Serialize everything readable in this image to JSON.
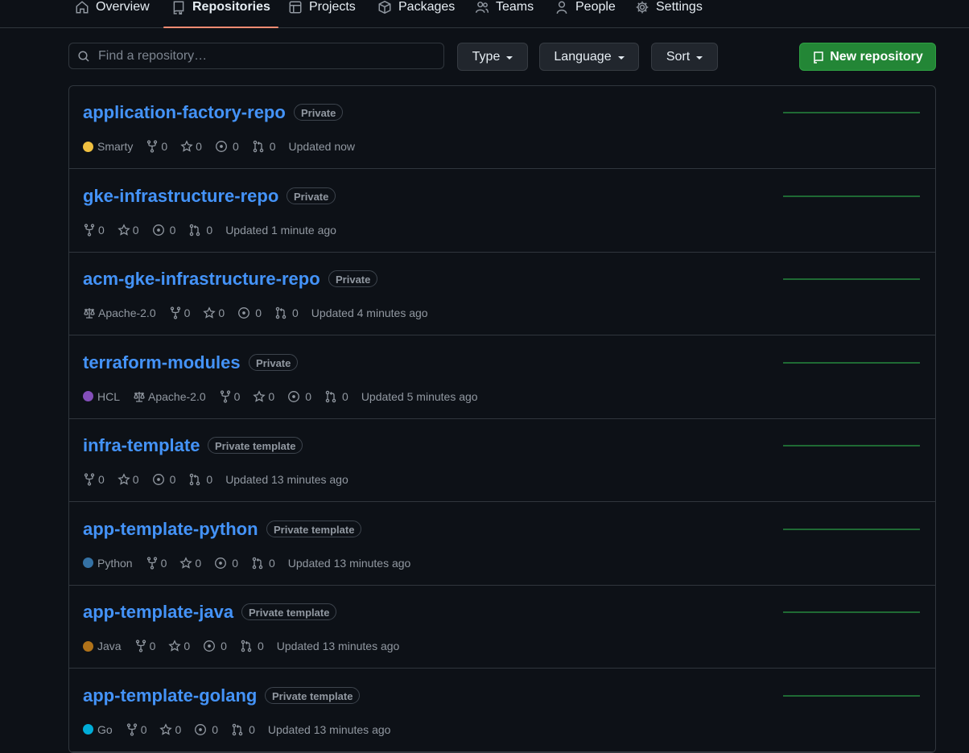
{
  "nav": {
    "tabs": [
      {
        "label": "Overview",
        "icon": "home-icon"
      },
      {
        "label": "Repositories",
        "icon": "repo-icon",
        "active": true
      },
      {
        "label": "Projects",
        "icon": "table-icon"
      },
      {
        "label": "Packages",
        "icon": "package-icon"
      },
      {
        "label": "Teams",
        "icon": "people-icon"
      },
      {
        "label": "People",
        "icon": "person-icon"
      },
      {
        "label": "Settings",
        "icon": "gear-icon"
      }
    ]
  },
  "toolbar": {
    "search_placeholder": "Find a repository…",
    "type_label": "Type",
    "language_label": "Language",
    "sort_label": "Sort",
    "new_repo_label": "New repository"
  },
  "colors": {
    "accent_link": "#4493f8",
    "primary_button": "#238636",
    "active_tab_underline": "#fd8c73",
    "Smarty": "#f0c040",
    "HCL": "#844fba",
    "Python": "#3572a5",
    "Java": "#b07219",
    "Go": "#00add8"
  },
  "repos": [
    {
      "name": "application-factory-repo",
      "visibility": "Private",
      "language": "Smarty",
      "license": "",
      "forks": "0",
      "stars": "0",
      "issues": "0",
      "prs": "0",
      "updated": "Updated now"
    },
    {
      "name": "gke-infrastructure-repo",
      "visibility": "Private",
      "language": "",
      "license": "",
      "forks": "0",
      "stars": "0",
      "issues": "0",
      "prs": "0",
      "updated": "Updated 1 minute ago"
    },
    {
      "name": "acm-gke-infrastructure-repo",
      "visibility": "Private",
      "language": "",
      "license": "Apache-2.0",
      "forks": "0",
      "stars": "0",
      "issues": "0",
      "prs": "0",
      "updated": "Updated 4 minutes ago"
    },
    {
      "name": "terraform-modules",
      "visibility": "Private",
      "language": "HCL",
      "license": "Apache-2.0",
      "forks": "0",
      "stars": "0",
      "issues": "0",
      "prs": "0",
      "updated": "Updated 5 minutes ago"
    },
    {
      "name": "infra-template",
      "visibility": "Private template",
      "language": "",
      "license": "",
      "forks": "0",
      "stars": "0",
      "issues": "0",
      "prs": "0",
      "updated": "Updated 13 minutes ago"
    },
    {
      "name": "app-template-python",
      "visibility": "Private template",
      "language": "Python",
      "license": "",
      "forks": "0",
      "stars": "0",
      "issues": "0",
      "prs": "0",
      "updated": "Updated 13 minutes ago"
    },
    {
      "name": "app-template-java",
      "visibility": "Private template",
      "language": "Java",
      "license": "",
      "forks": "0",
      "stars": "0",
      "issues": "0",
      "prs": "0",
      "updated": "Updated 13 minutes ago"
    },
    {
      "name": "app-template-golang",
      "visibility": "Private template",
      "language": "Go",
      "license": "",
      "forks": "0",
      "stars": "0",
      "issues": "0",
      "prs": "0",
      "updated": "Updated 13 minutes ago"
    }
  ]
}
